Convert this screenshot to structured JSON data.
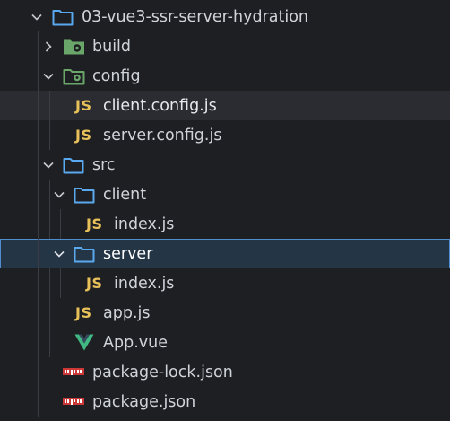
{
  "tree": {
    "root": {
      "label": "03-vue3-ssr-server-hydration",
      "icon": "folder-open-icon",
      "expanded": true
    },
    "items": [
      {
        "label": "build",
        "icon": "config-folder-icon",
        "expanded": false
      },
      {
        "label": "config",
        "icon": "config-folder-open-icon",
        "expanded": true
      },
      {
        "label": "client.config.js",
        "icon": "js-file-icon",
        "icon_text": "JS"
      },
      {
        "label": "server.config.js",
        "icon": "js-file-icon",
        "icon_text": "JS"
      },
      {
        "label": "src",
        "icon": "folder-open-icon",
        "expanded": true
      },
      {
        "label": "client",
        "icon": "folder-open-icon",
        "expanded": true
      },
      {
        "label": "index.js",
        "icon": "js-file-icon",
        "icon_text": "JS"
      },
      {
        "label": "server",
        "icon": "folder-open-icon",
        "expanded": true,
        "selected": true
      },
      {
        "label": "index.js",
        "icon": "js-file-icon",
        "icon_text": "JS"
      },
      {
        "label": "app.js",
        "icon": "js-file-icon",
        "icon_text": "JS"
      },
      {
        "label": "App.vue",
        "icon": "vue-file-icon"
      },
      {
        "label": "package-lock.json",
        "icon": "npm-file-icon",
        "icon_text": "npm"
      },
      {
        "label": "package.json",
        "icon": "npm-file-icon",
        "icon_text": "npm"
      }
    ]
  },
  "colors": {
    "background": "#1e1f22",
    "folder": "#5aa9ee",
    "config_folder": "#6aa56a",
    "js": "#e8c15a",
    "vue": "#41b883",
    "npm": "#cb3837",
    "selection": "#243546",
    "selection_border": "#4f8fcf"
  }
}
